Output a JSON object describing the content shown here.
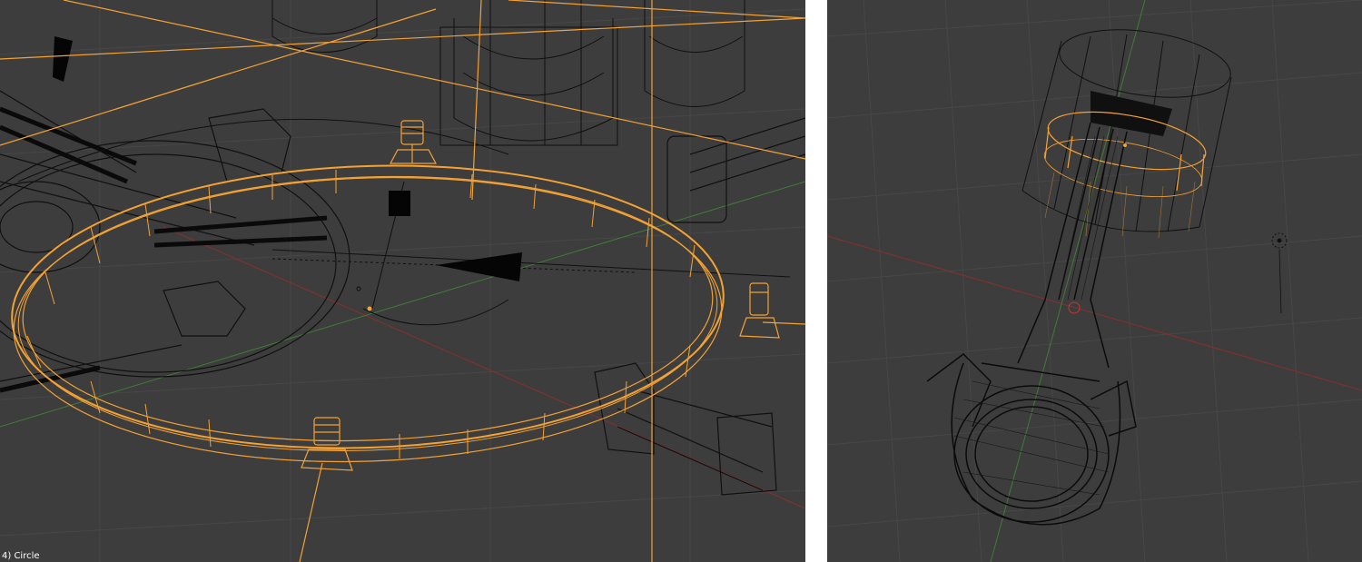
{
  "left_viewport": {
    "object_label": "4) Circle"
  },
  "right_viewport": {},
  "colors": {
    "viewport_bg": "#3d3d3d",
    "grid": "#474747",
    "wire": "#101010",
    "selected_wire": "#f4a234",
    "x_axis": "#8a2f2f",
    "y_axis": "#3f7d36",
    "separator": "#ffffff"
  }
}
